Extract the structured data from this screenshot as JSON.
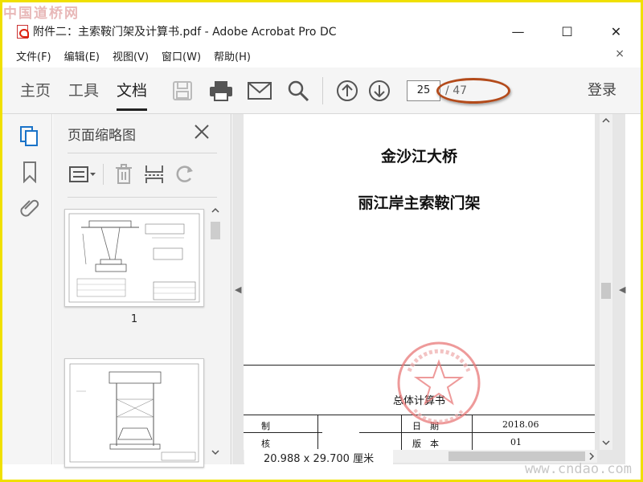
{
  "watermark": {
    "top_left": "中国道桥网",
    "bottom_right": "www.cndao.com"
  },
  "window": {
    "title": "附件二：主索鞍门架及计算书.pdf - Adobe Acrobat Pro DC",
    "minimize": "—",
    "maximize": "☐",
    "close": "✕"
  },
  "menu": {
    "items": [
      "文件(F)",
      "编辑(E)",
      "视图(V)",
      "窗口(W)",
      "帮助(H)"
    ],
    "close": "×"
  },
  "toolbar": {
    "tabs": [
      "主页",
      "工具",
      "文档"
    ],
    "active_tab": "文档",
    "current_page": "25",
    "total_pages": "/ 47",
    "login": "登录",
    "annotation_color": "#b34a1a"
  },
  "thumbnails": {
    "header": "页面缩略图",
    "close": "✕",
    "pages": [
      {
        "label": "1"
      },
      {
        "label": ""
      }
    ]
  },
  "document": {
    "title1": "金沙江大桥",
    "title2": "丽江岸主索鞍门架",
    "subtitle": "总体计算书",
    "table": {
      "row1": {
        "c1": "制",
        "c2": "日　期",
        "c3": "2018.06"
      },
      "row2": {
        "c1": "核",
        "c2": "版　本",
        "c3": "01"
      }
    },
    "stamp_text": "勘察设计研究院有限公司 技术文件专用章"
  },
  "status": {
    "page_size": "20.988 x 29.700 厘米"
  }
}
